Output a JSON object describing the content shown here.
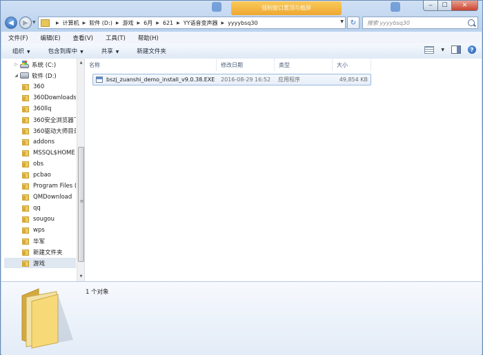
{
  "ghost_tab": {
    "text": "强制窗口置顶与截屏"
  },
  "window_controls": {
    "minimize": "‒",
    "maximize": "☐",
    "close": "✕"
  },
  "address": {
    "breadcrumbs": [
      "计算机",
      "软件 (D:)",
      "游戏",
      "6月",
      "621",
      "YY语音变声器",
      "yyyybsq30"
    ],
    "search_placeholder": "搜索 yyyybsq30"
  },
  "menu": [
    "文件(F)",
    "编辑(E)",
    "查看(V)",
    "工具(T)",
    "帮助(H)"
  ],
  "commands": [
    {
      "label": "组织",
      "dropdown": true
    },
    {
      "label": "包含到库中",
      "dropdown": true
    },
    {
      "label": "共享",
      "dropdown": true
    },
    {
      "label": "新建文件夹",
      "dropdown": false
    }
  ],
  "nav": [
    {
      "label": "系统 (C:)",
      "icon": "system-drive-icon",
      "level": 0
    },
    {
      "label": "软件 (D:)",
      "icon": "drive-icon",
      "level": 0
    },
    {
      "label": "360",
      "icon": "folder-icon",
      "level": 1
    },
    {
      "label": "360Downloads",
      "icon": "folder-icon",
      "level": 1
    },
    {
      "label": "360llq",
      "icon": "folder-icon",
      "level": 1
    },
    {
      "label": "360安全浏览器下",
      "icon": "folder-icon",
      "level": 1
    },
    {
      "label": "360驱动大师目录",
      "icon": "folder-icon",
      "level": 1
    },
    {
      "label": "addons",
      "icon": "folder-icon",
      "level": 1
    },
    {
      "label": "MSSQL$HOME",
      "icon": "folder-icon",
      "level": 1
    },
    {
      "label": "obs",
      "icon": "folder-icon",
      "level": 1
    },
    {
      "label": "pcbao",
      "icon": "folder-icon",
      "level": 1
    },
    {
      "label": "Program Files (",
      "icon": "folder-icon",
      "level": 1
    },
    {
      "label": "QMDownload",
      "icon": "folder-icon",
      "level": 1
    },
    {
      "label": "qq",
      "icon": "folder-icon",
      "level": 1
    },
    {
      "label": "sougou",
      "icon": "folder-icon",
      "level": 1
    },
    {
      "label": "wps",
      "icon": "folder-icon",
      "level": 1
    },
    {
      "label": "华军",
      "icon": "folder-icon",
      "level": 1
    },
    {
      "label": "新建文件夹",
      "icon": "folder-icon",
      "level": 1
    },
    {
      "label": "游戏",
      "icon": "folder-icon",
      "level": 1,
      "selected": true
    }
  ],
  "columns": [
    "名称",
    "修改日期",
    "类型",
    "大小"
  ],
  "files": [
    {
      "name": "bszj_zuanshi_demo_install_v9.0.38.EXE",
      "date": "2016-08-29 16:52",
      "type": "应用程序",
      "size": "49,854 KB"
    }
  ],
  "status": {
    "count": "1 个对象"
  }
}
